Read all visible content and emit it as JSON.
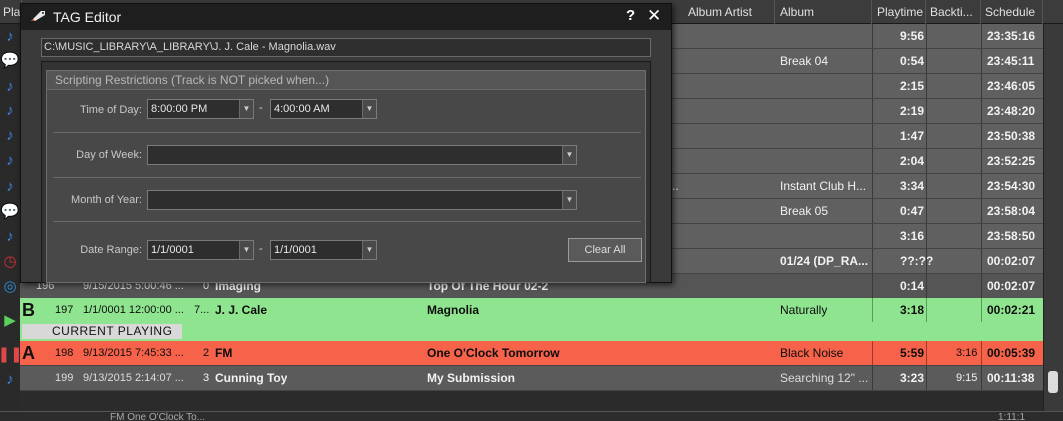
{
  "header": {
    "columns": [
      "Pla",
      "Album Artist",
      "Album",
      "Playtime",
      "Backti...",
      "Schedule"
    ]
  },
  "background_rows": [
    {
      "album": "",
      "playtime": "9:56",
      "schedule": "23:35:16"
    },
    {
      "album": "Break 04",
      "playtime": "0:54",
      "schedule": "23:45:11"
    },
    {
      "album": "",
      "playtime": "2:15",
      "schedule": "23:46:05"
    },
    {
      "album": "",
      "playtime": "2:19",
      "schedule": "23:48:20"
    },
    {
      "album": "",
      "playtime": "1:47",
      "schedule": "23:50:38"
    },
    {
      "album": "",
      "playtime": "2:04",
      "schedule": "23:52:25"
    },
    {
      "title_tail": "..",
      "album": "Instant Club H...",
      "playtime": "3:34",
      "schedule": "23:54:30"
    },
    {
      "album": "Break 05",
      "playtime": "0:47",
      "schedule": "23:58:04"
    },
    {
      "album": "",
      "playtime": "3:16",
      "schedule": "23:58:50"
    },
    {
      "album": "01/24 (DP_RA...",
      "playtime": "??:??",
      "schedule": "00:02:07"
    }
  ],
  "rows": [
    {
      "num": "196",
      "date": "9/15/2015 5:00:46 ...",
      "idx": "0",
      "artist": "Imaging",
      "title": "Top Of The Hour 02-2",
      "album": "",
      "playtime": "0:14",
      "backtime": "",
      "schedule": "00:02:07"
    },
    {
      "letter": "B",
      "num": "197",
      "date": "1/1/0001 12:00:00 ...",
      "idx": "7...",
      "artist": "J. J. Cale",
      "title": "Magnolia",
      "album": "Naturally",
      "playtime": "3:18",
      "backtime": "",
      "schedule": "00:02:21"
    },
    {
      "letter": "A",
      "num": "198",
      "date": "9/13/2015 7:45:33 ...",
      "idx": "2",
      "artist": "FM",
      "title": "One O'Clock Tomorrow",
      "album": "Black Noise",
      "playtime": "5:59",
      "backtime": "3:16",
      "schedule": "00:05:39"
    },
    {
      "num": "199",
      "date": "9/13/2015 2:14:07 ...",
      "idx": "3",
      "artist": "Cunning Toy",
      "title": "My Submission",
      "album": "Searching 12\" ...",
      "playtime": "3:23",
      "backtime": "9:15",
      "schedule": "00:11:38"
    }
  ],
  "current_playing": "CURRENT   PLAYING",
  "bottom_text": "FM    One O'Clock To...",
  "bottom_right": "1:11:1",
  "icons": [
    "music-note-icon",
    "speech-bubble-icon",
    "music-note-icon",
    "music-note-icon",
    "music-note-icon",
    "music-note-icon",
    "music-note-icon",
    "speech-bubble-icon",
    "music-note-icon",
    "clock-icon",
    "target-icon",
    "play-icon",
    "pause-icon",
    "music-note-icon"
  ],
  "dialog": {
    "title": "TAG Editor",
    "help": "?",
    "close": "✕",
    "path": "C:\\MUSIC_LIBRARY\\A_LIBRARY\\J. J. Cale - Magnolia.wav",
    "group_title": "Scripting Restrictions (Track is NOT picked when...)",
    "time_of_day_label": "Time of Day:",
    "time_from": "8:00:00 PM",
    "time_to": "4:00:00 AM",
    "day_of_week_label": "Day of Week:",
    "day_of_week_value": "",
    "month_of_year_label": "Month of Year:",
    "month_of_year_value": "",
    "date_range_label": "Date Range:",
    "date_from": "1/1/0001",
    "date_to": "1/1/0001",
    "dash": "-",
    "clear_all": "Clear All"
  },
  "colors": {
    "playing_row": "#8fe58f",
    "next_row": "#f6624a",
    "accent_note": "#3f86e6"
  }
}
